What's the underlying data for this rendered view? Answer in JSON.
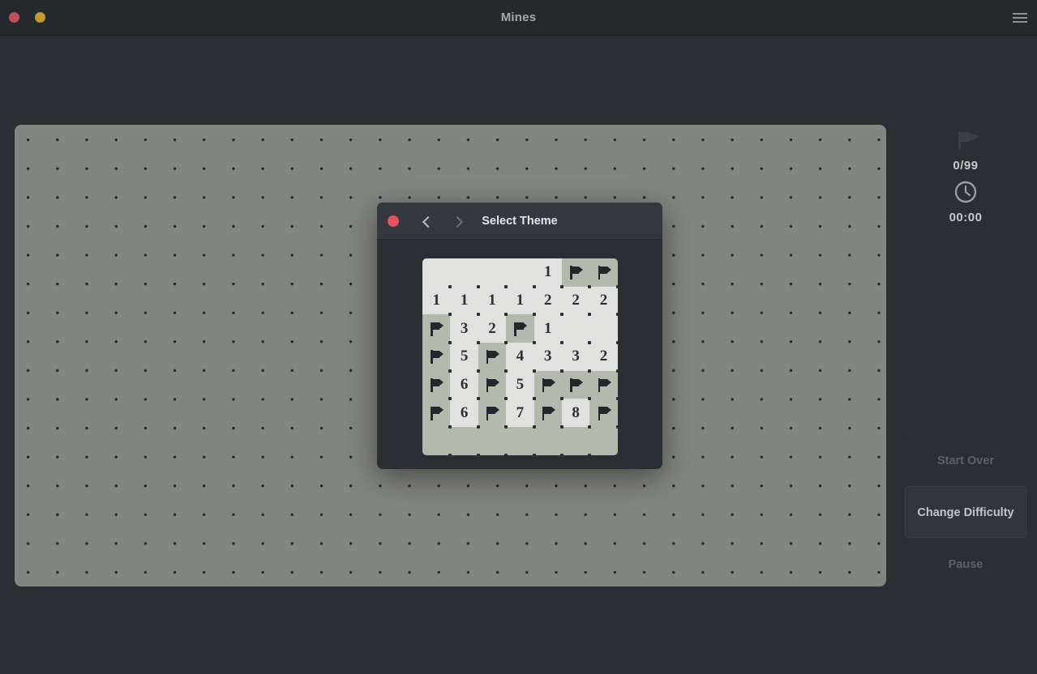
{
  "window": {
    "title": "Mines",
    "close_dot": "close-dot",
    "minimize_dot": "minimize-dot",
    "menu_label": "menu",
    "colors": {
      "close": "#bf4f5a",
      "minimize": "#c49a33",
      "titlebar": "#26282c"
    }
  },
  "side_panel": {
    "flag_icon": "flag-icon",
    "flag_count": "0/99",
    "clock_icon": "clock-icon",
    "timer": "00:00",
    "buttons": [
      {
        "label": "Start Over",
        "state": "disabled"
      },
      {
        "label": "Change Difficulty",
        "state": "active"
      },
      {
        "label": "Pause",
        "state": "disabled"
      }
    ]
  },
  "board": {
    "background_color": "#83857f",
    "dot_color": "#22252a"
  },
  "dialog": {
    "title": "Select Theme",
    "close_button": "close",
    "back_button": "previous-theme",
    "forward_button": "next-theme",
    "preview": {
      "columns": 7,
      "rows": 7,
      "revealed_color": "#e1e1df",
      "hidden_color": "#b4b9ae",
      "number_color": "#2b3034",
      "cells": [
        [
          "empty",
          "empty",
          "empty",
          "empty",
          "1",
          "flag",
          "flag"
        ],
        [
          "1",
          "1",
          "1",
          "1",
          "2",
          "2",
          "2"
        ],
        [
          "flag",
          "3",
          "2",
          "flag",
          "1",
          "empty",
          "empty"
        ],
        [
          "flag",
          "5",
          "flag",
          "4",
          "3",
          "3",
          "2"
        ],
        [
          "flag",
          "6",
          "flag",
          "5",
          "flag",
          "flag",
          "flag"
        ],
        [
          "flag",
          "6",
          "flag",
          "7",
          "flag",
          "8",
          "flag"
        ],
        [
          "hidden",
          "hidden",
          "hidden",
          "hidden",
          "hidden",
          "hidden",
          "hidden"
        ]
      ]
    }
  }
}
